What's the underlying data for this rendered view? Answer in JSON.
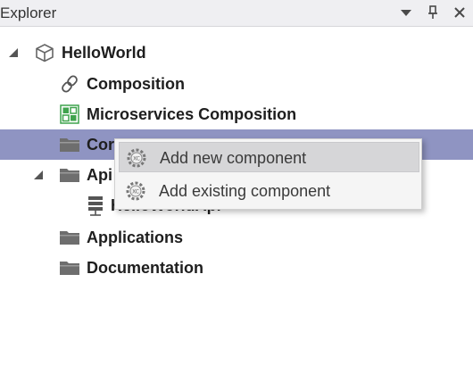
{
  "panel": {
    "title": "Explorer",
    "controls": {
      "dropdown_icon": "chevron-down-icon",
      "pin_icon": "pin-icon",
      "close_icon": "close-icon"
    }
  },
  "tree": {
    "root": {
      "label": "HelloWorld",
      "icon": "cube-icon",
      "expanded": true
    },
    "items": [
      {
        "label": "Composition",
        "icon": "link-icon"
      },
      {
        "label": "Microservices Composition",
        "icon": "grid-icon"
      },
      {
        "label": "Cor",
        "icon": "folder-icon",
        "selected": true
      },
      {
        "label": "Api",
        "icon": "folder-icon",
        "expanded": true
      },
      {
        "label": "HelloWorldApi",
        "icon": "server-icon"
      },
      {
        "label": "Applications",
        "icon": "folder-icon"
      },
      {
        "label": "Documentation",
        "icon": "folder-icon"
      }
    ]
  },
  "context_menu": {
    "items": [
      {
        "label": "Add new component",
        "icon": "component-gear-icon",
        "hover": true
      },
      {
        "label": "Add existing component",
        "icon": "component-gear-icon"
      }
    ]
  },
  "colors": {
    "selection": "#8f94c2",
    "titlebar": "#efeff2",
    "folder": "#6e6e6e",
    "grid_green": "#3fa34d"
  }
}
